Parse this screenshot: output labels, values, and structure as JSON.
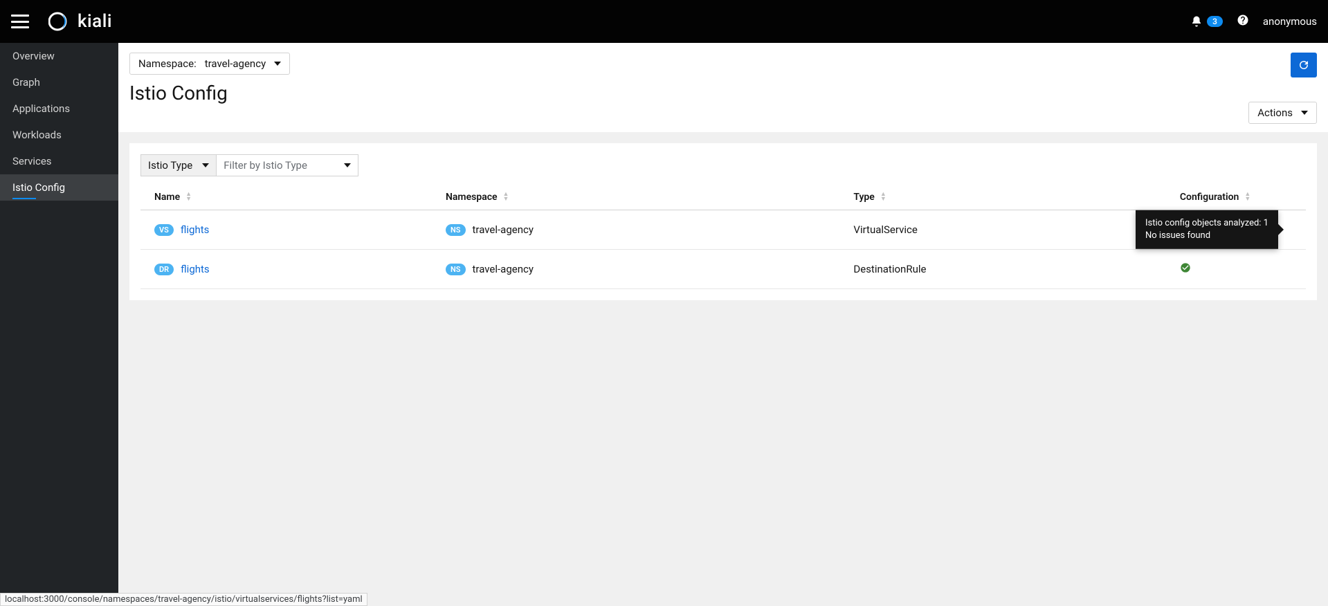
{
  "masthead": {
    "brand": "kiali",
    "notifications": "3",
    "user": "anonymous"
  },
  "sidebar": {
    "items": [
      {
        "label": "Overview"
      },
      {
        "label": "Graph"
      },
      {
        "label": "Applications"
      },
      {
        "label": "Workloads"
      },
      {
        "label": "Services"
      },
      {
        "label": "Istio Config"
      }
    ]
  },
  "header": {
    "ns_label": "Namespace:",
    "ns_value": "travel-agency",
    "title": "Istio Config",
    "actions_label": "Actions"
  },
  "filter": {
    "type_label": "Istio Type",
    "placeholder": "Filter by Istio Type"
  },
  "columns": {
    "name": "Name",
    "namespace": "Namespace",
    "type": "Type",
    "config": "Configuration"
  },
  "rows": [
    {
      "badge": "VS",
      "name": "flights",
      "ns_badge": "NS",
      "namespace": "travel-agency",
      "type": "VirtualService",
      "tooltip_line1": "Istio config objects analyzed: 1",
      "tooltip_line2": "No issues found",
      "show_tooltip": true
    },
    {
      "badge": "DR",
      "name": "flights",
      "ns_badge": "NS",
      "namespace": "travel-agency",
      "type": "DestinationRule",
      "show_tooltip": false
    }
  ],
  "status_url": "localhost:3000/console/namespaces/travel-agency/istio/virtualservices/flights?list=yaml"
}
